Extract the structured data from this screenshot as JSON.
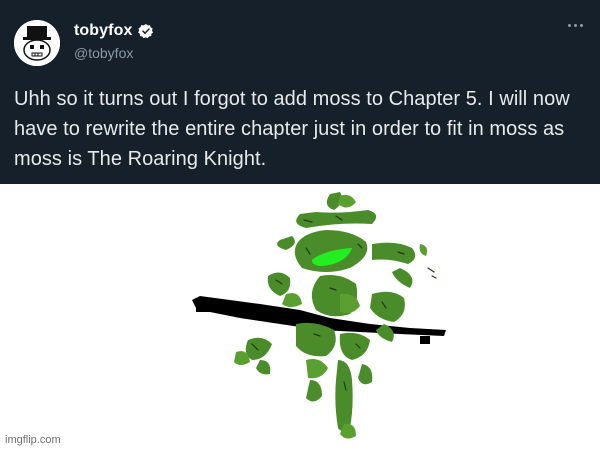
{
  "tweet": {
    "display_name": "tobyfox",
    "handle": "@tobyfox",
    "text": "Uhh so it turns out I forgot to add moss to Chapter 5. I will now have to rewrite the entire chapter just in order to fit in moss as moss is The Roaring Knight.",
    "verified": true,
    "icons": {
      "avatar": "tobyfox-avatar-icon",
      "verified": "verified-badge-icon",
      "more": "more-options-icon"
    },
    "colors": {
      "background": "#15202b",
      "text": "#e7e9ea",
      "handle": "#8b98a5"
    }
  },
  "image": {
    "description_icon": "moss-knight-drawing",
    "colors": {
      "moss": "#4a8c2a",
      "moss_light": "#5aa030",
      "highlight": "#22ee22",
      "sword": "#000000"
    }
  },
  "watermark": "imgflip.com"
}
